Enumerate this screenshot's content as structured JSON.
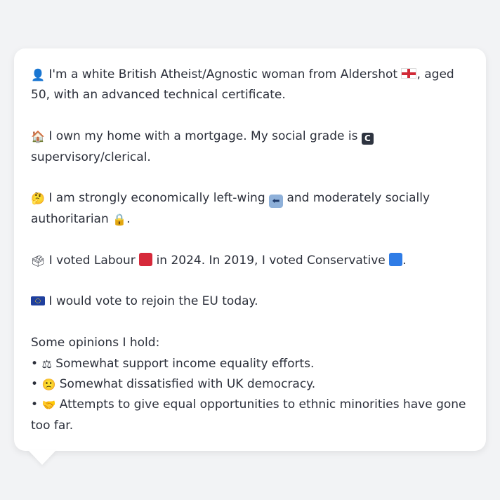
{
  "profile": {
    "line1": {
      "icon": "person-silhouette-icon",
      "text_a": "I'm a white British Atheist/Agnostic woman from Aldershot",
      "flag_icon": "england-flag-icon",
      "text_b": ", aged 50, with an advanced technical certificate."
    },
    "line2": {
      "icon": "house-icon",
      "text_a": "I own my home with a mortgage. My social grade is",
      "grade_badge": "C",
      "text_b": "supervisory/clerical."
    },
    "line3": {
      "icon": "thinking-face-icon",
      "text_a": "I am strongly economically left-wing",
      "left_arrow_icon": "left-arrow-icon",
      "text_b": "and moderately socially authoritarian",
      "lock_icon": "lock-icon",
      "text_c": "."
    },
    "line4": {
      "icon": "ballot-box-icon",
      "text_a": "I voted Labour",
      "labour_color": "#d6293a",
      "text_b": "in 2024. In 2019, I voted Conservative",
      "conservative_color": "#2f7ce6",
      "text_c": "."
    },
    "line5": {
      "icon": "eu-flag-icon",
      "text": "I would vote to rejoin the EU today."
    },
    "opinions": {
      "heading": "Some opinions I hold:",
      "bullet": "•",
      "items": [
        {
          "icon": "balance-scale-icon",
          "text": "Somewhat support income equality efforts."
        },
        {
          "icon": "slightly-frowning-face-icon",
          "text": "Somewhat dissatisfied with UK democracy."
        },
        {
          "icon": "handshake-icon",
          "text": "Attempts to give equal opportunities to ethnic minorities have gone too far."
        }
      ]
    }
  }
}
